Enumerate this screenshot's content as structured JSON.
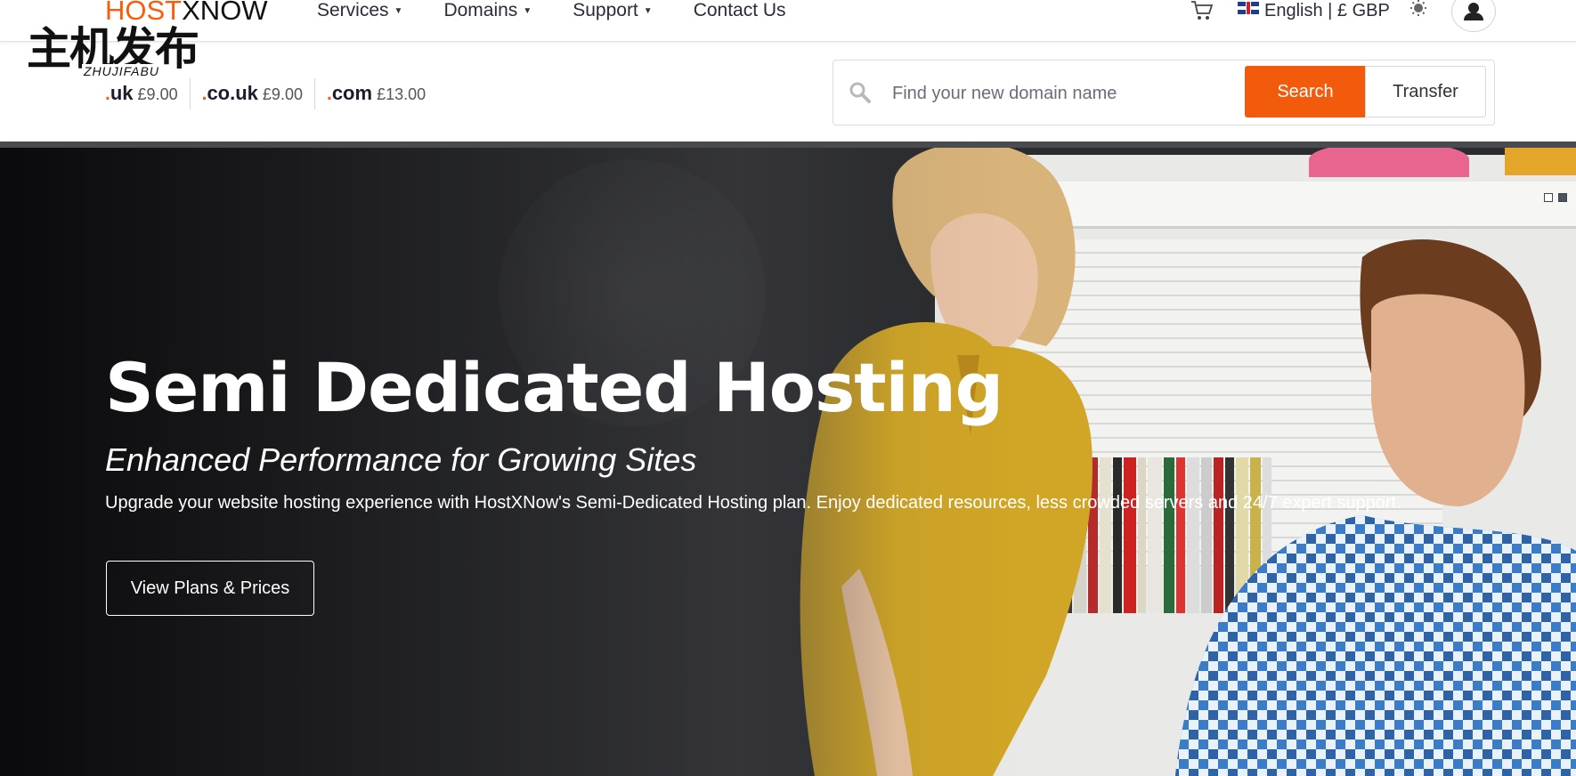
{
  "brand": {
    "logo_part1": "HOST",
    "logo_part2": "XNOW"
  },
  "watermark": {
    "chinese": "主机发布",
    "latin": "ZHUJIFABU"
  },
  "nav": {
    "items": [
      {
        "label": "Services",
        "dropdown": true
      },
      {
        "label": "Domains",
        "dropdown": true
      },
      {
        "label": "Support",
        "dropdown": true
      },
      {
        "label": "Contact Us",
        "dropdown": false
      }
    ],
    "language_currency": "English | £ GBP",
    "cart_icon": "cart-icon",
    "theme_icon": "sun-icon",
    "account_icon": "user-icon"
  },
  "tlds": [
    {
      "ext": "uk",
      "price": "£9.00"
    },
    {
      "ext": "co.uk",
      "price": "£9.00"
    },
    {
      "ext": "com",
      "price": "£13.00"
    }
  ],
  "domain_search": {
    "placeholder": "Find your new domain name",
    "search_label": "Search",
    "transfer_label": "Transfer"
  },
  "hero": {
    "title": "Semi Dedicated Hosting",
    "subtitle": "Enhanced Performance for Growing Sites",
    "description": "Upgrade your website hosting experience with HostXNow's Semi-Dedicated Hosting plan. Enjoy dedicated resources, less crowded servers and 24/7 expert support.",
    "cta_label": "View Plans & Prices"
  },
  "colors": {
    "accent": "#f25a0c",
    "text_dark": "#2b2b3a"
  }
}
